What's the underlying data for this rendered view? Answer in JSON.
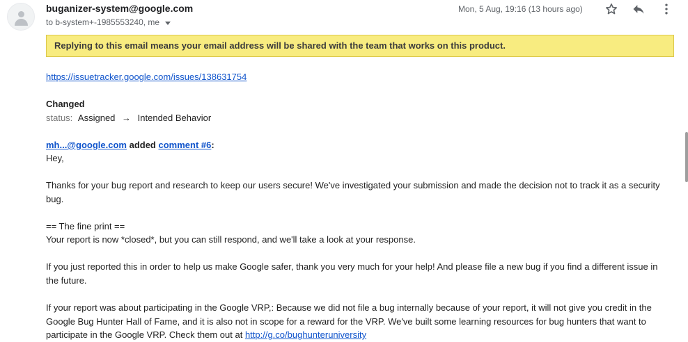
{
  "header": {
    "sender": "buganizer-system@google.com",
    "recipients": "to b-system+-1985553240, me",
    "date": "Mon, 5 Aug, 19:16 (13 hours ago)",
    "star_icon": "star-outline-icon",
    "reply_icon": "reply-icon",
    "more_icon": "more-vert-icon"
  },
  "banner": {
    "text": "Replying to this email means your email address will be shared with the team that works on this product."
  },
  "body": {
    "issue_link": "https://issuetracker.google.com/issues/138631754",
    "changed_heading": "Changed",
    "status_label": "status:",
    "status_from": "Assigned",
    "status_arrow": "→",
    "status_to": "Intended Behavior",
    "commenter": "mh...@google.com",
    "added_text": "added",
    "comment_link": "comment #6",
    "colon": ":",
    "greeting": "Hey,",
    "para1": "Thanks for your bug report and research to keep our users secure! We've investigated your submission and made the decision not to track it as a security bug.",
    "fine_print_heading": "==  The fine print ==",
    "para2": "Your report is now *closed*, but you can still respond, and we'll take a look at your response.",
    "para3": "If you just reported this in order to help us make Google safer, thank you very much for your help! And please file a new bug if you find a different issue in the future.",
    "para4": "If your report was about participating in the Google VRP,: Because we did not file a bug internally because of your report, it will not give you credit in the Google Bug Hunter Hall of Fame, and it is also not in scope for a reward for the VRP. We've built some learning resources for bug hunters that want to participate in the Google VRP. Check them out at",
    "para4_link": "http://g.co/bughunteruniversity"
  },
  "colors": {
    "banner_bg": "#f8ec80",
    "link": "#1155cc"
  }
}
